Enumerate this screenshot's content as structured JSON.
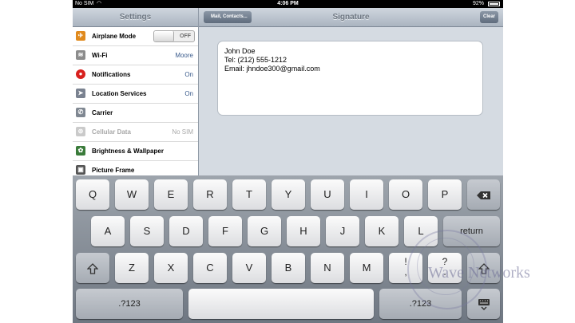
{
  "status_bar": {
    "carrier": "No SIM",
    "time": "4:06 PM",
    "battery": "92%"
  },
  "sidebar": {
    "title": "Settings",
    "items": [
      {
        "label": "Airplane Mode",
        "toggle": "OFF",
        "icon": "airplane-icon",
        "color": "#e08a1e"
      },
      {
        "label": "Wi-Fi",
        "value": "Moore",
        "icon": "wifi-icon",
        "color": "#8c8c8c"
      },
      {
        "label": "Notifications",
        "value": "On",
        "icon": "notifications-icon",
        "color": "#d8211e"
      },
      {
        "label": "Location Services",
        "value": "On",
        "icon": "location-icon",
        "color": "#7a8290"
      },
      {
        "label": "Carrier",
        "value": "",
        "icon": "phone-icon",
        "color": "#7f8791"
      },
      {
        "label": "Cellular Data",
        "value": "No SIM",
        "icon": "cellular-icon",
        "color": "#8c8c8c",
        "disabled": true
      },
      {
        "label": "Brightness & Wallpaper",
        "value": "",
        "icon": "brightness-icon",
        "color": "#3a7b3a"
      },
      {
        "label": "Picture Frame",
        "value": "",
        "icon": "picture-frame-icon",
        "color": "#555555"
      }
    ]
  },
  "detail": {
    "title": "Signature",
    "back_label": "Mail, Contacts...",
    "clear_label": "Clear",
    "signature_lines": [
      "John Doe",
      "Tel: (212) 555-1212",
      "Email: jhndoe300@gmail.com"
    ]
  },
  "keyboard": {
    "row1": [
      "Q",
      "W",
      "E",
      "R",
      "T",
      "Y",
      "U",
      "I",
      "O",
      "P"
    ],
    "row2": [
      "A",
      "S",
      "D",
      "F",
      "G",
      "H",
      "J",
      "K",
      "L"
    ],
    "row3": [
      "Z",
      "X",
      "C",
      "V",
      "B",
      "N",
      "M"
    ],
    "return_label": "return",
    "numbers_label": ".?123",
    "punct1_top": "!",
    "punct1_bottom": ",",
    "punct2_top": "?",
    "punct2_bottom": "."
  },
  "watermark": "Wave Networks"
}
